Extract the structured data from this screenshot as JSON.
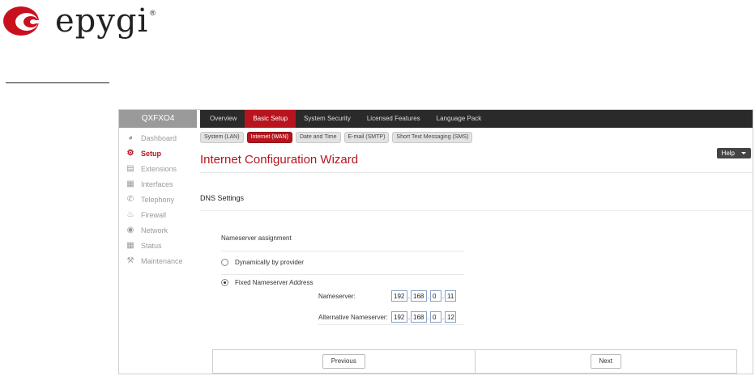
{
  "logo": {
    "text": "epygi",
    "reg": "®"
  },
  "device": "QXFXO4",
  "sidebar": {
    "items": [
      {
        "label": "Dashboard",
        "icon": "dashboard-icon",
        "active": false
      },
      {
        "label": "Setup",
        "icon": "gear-icon",
        "active": true
      },
      {
        "label": "Extensions",
        "icon": "extensions-icon",
        "active": false
      },
      {
        "label": "Interfaces",
        "icon": "interfaces-icon",
        "active": false
      },
      {
        "label": "Telephony",
        "icon": "phone-icon",
        "active": false
      },
      {
        "label": "Firewall",
        "icon": "flame-icon",
        "active": false
      },
      {
        "label": "Network",
        "icon": "globe-icon",
        "active": false
      },
      {
        "label": "Status",
        "icon": "chart-icon",
        "active": false
      },
      {
        "label": "Maintenance",
        "icon": "wrench-icon",
        "active": false
      }
    ]
  },
  "topnav": {
    "tabs": [
      "Overview",
      "Basic Setup",
      "System Security",
      "Licensed Features",
      "Language Pack"
    ],
    "active": "Basic Setup"
  },
  "subnav": {
    "tabs": [
      "System (LAN)",
      "Internet (WAN)",
      "Date and Time",
      "E-mail (SMTP)",
      "Short Text Messaging (SMS)"
    ],
    "active": "Internet (WAN)"
  },
  "help_label": "Help",
  "page_title": "Internet Configuration Wizard",
  "section_title": "DNS Settings",
  "form": {
    "assignment_label": "Nameserver assignment",
    "option_dynamic": "Dynamically by provider",
    "option_fixed": "Fixed Nameserver Address",
    "selected": "Fixed Nameserver Address",
    "nameserver_label": "Nameserver:",
    "nameserver": [
      "192",
      "168",
      "0",
      "11"
    ],
    "alt_nameserver_label": "Alternative Nameserver:",
    "alt_nameserver": [
      "192",
      "168",
      "0",
      "12"
    ]
  },
  "buttons": {
    "previous": "Previous",
    "next": "Next"
  },
  "colors": {
    "accent": "#b8141d",
    "topnav_bg": "#2a2a2a",
    "sidebar_header": "#9a9a9a"
  }
}
